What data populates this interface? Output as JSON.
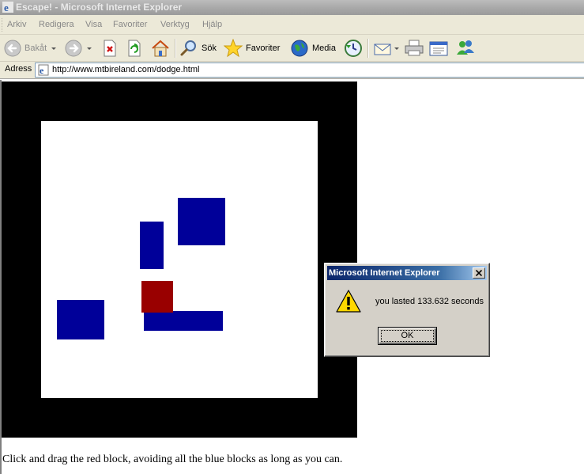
{
  "window": {
    "title": "Escape! - Microsoft Internet Explorer"
  },
  "menubar": {
    "items": [
      "Arkiv",
      "Redigera",
      "Visa",
      "Favoriter",
      "Verktyg",
      "Hjälp"
    ]
  },
  "toolbar": {
    "back_label": "Bakåt",
    "search_label": "Sök",
    "favorites_label": "Favoriter",
    "media_label": "Media"
  },
  "addressbar": {
    "label": "Adress",
    "url": "http://www.mtbireland.com/dodge.html"
  },
  "page": {
    "instructions": "Click and drag the red block, avoiding all the blue blocks as long as you can."
  },
  "game": {
    "frame_color": "#000000",
    "field_color": "#ffffff",
    "player_color": "#990000",
    "enemy_color": "#000099"
  },
  "dialog": {
    "title": "Microsoft Internet Explorer",
    "message": "you lasted 133.632 seconds",
    "ok_label": "OK"
  },
  "icons": {
    "back": "back-arrow-icon",
    "forward": "forward-arrow-icon",
    "stop": "stop-icon",
    "refresh": "refresh-icon",
    "home": "home-icon",
    "search": "search-magnifier-icon",
    "favorites": "favorites-star-icon",
    "media": "media-globe-icon",
    "history": "history-icon",
    "mail": "mail-envelope-icon",
    "print": "printer-icon",
    "edit": "edit-icon",
    "messenger": "messenger-icon",
    "warning": "warning-icon"
  }
}
